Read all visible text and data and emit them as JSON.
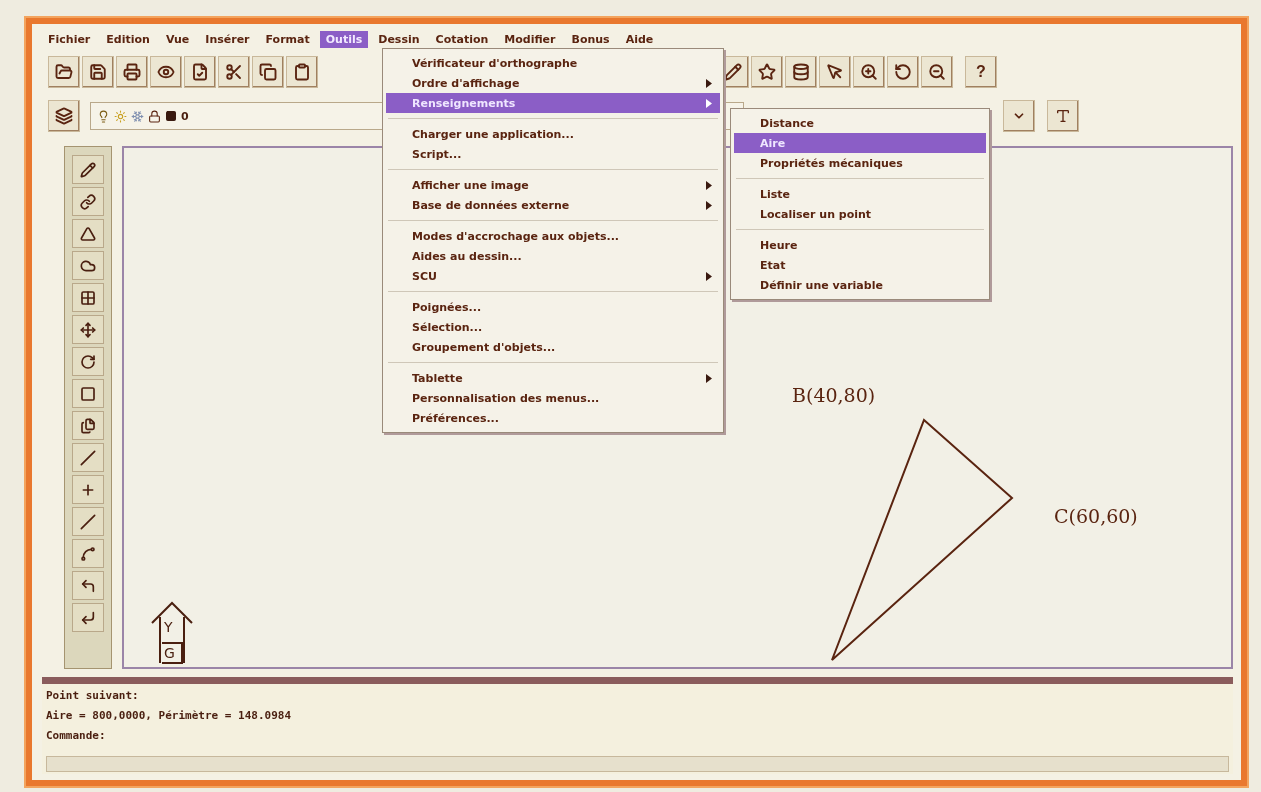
{
  "menu_bar": [
    {
      "label": "Fichier",
      "selected": false
    },
    {
      "label": "Edition",
      "selected": false
    },
    {
      "label": "Vue",
      "selected": false
    },
    {
      "label": "Insérer",
      "selected": false
    },
    {
      "label": "Format",
      "selected": false
    },
    {
      "label": "Outils",
      "selected": true
    },
    {
      "label": "Dessin",
      "selected": false
    },
    {
      "label": "Cotation",
      "selected": false
    },
    {
      "label": "Modifier",
      "selected": false
    },
    {
      "label": "Bonus",
      "selected": false
    },
    {
      "label": "Aide",
      "selected": false
    }
  ],
  "help_button": "?",
  "layer": {
    "name": "0"
  },
  "tools_menu": {
    "sections": [
      {
        "items": [
          {
            "label": "Vérificateur d'orthographe",
            "has_submenu": false,
            "selected": false
          },
          {
            "label": "Ordre d'affichage",
            "has_submenu": true,
            "selected": false
          },
          {
            "label": "Renseignements",
            "has_submenu": true,
            "selected": true
          }
        ]
      },
      {
        "items": [
          {
            "label": "Charger une application...",
            "has_submenu": false,
            "selected": false
          },
          {
            "label": "Script...",
            "has_submenu": false,
            "selected": false
          }
        ]
      },
      {
        "items": [
          {
            "label": "Afficher une image",
            "has_submenu": true,
            "selected": false
          },
          {
            "label": "Base de données externe",
            "has_submenu": true,
            "selected": false
          }
        ]
      },
      {
        "items": [
          {
            "label": "Modes d'accrochage aux objets...",
            "has_submenu": false,
            "selected": false
          },
          {
            "label": "Aides au dessin...",
            "has_submenu": false,
            "selected": false
          },
          {
            "label": "SCU",
            "has_submenu": true,
            "selected": false
          }
        ]
      },
      {
        "items": [
          {
            "label": "Poignées...",
            "has_submenu": false,
            "selected": false
          },
          {
            "label": "Sélection...",
            "has_submenu": false,
            "selected": false
          },
          {
            "label": "Groupement d'objets...",
            "has_submenu": false,
            "selected": false
          }
        ]
      },
      {
        "items": [
          {
            "label": "Tablette",
            "has_submenu": true,
            "selected": false
          },
          {
            "label": "Personnalisation des menus...",
            "has_submenu": false,
            "selected": false
          },
          {
            "label": "Préférences...",
            "has_submenu": false,
            "selected": false
          }
        ]
      }
    ]
  },
  "info_submenu": {
    "sections": [
      {
        "items": [
          {
            "label": "Distance",
            "selected": false
          },
          {
            "label": "Aire",
            "selected": true
          },
          {
            "label": "Propriétés mécaniques",
            "selected": false
          }
        ]
      },
      {
        "items": [
          {
            "label": "Liste",
            "selected": false
          },
          {
            "label": "Localiser un point",
            "selected": false
          }
        ]
      },
      {
        "items": [
          {
            "label": "Heure",
            "selected": false
          },
          {
            "label": "Etat",
            "selected": false
          },
          {
            "label": "Définir une variable",
            "selected": false
          }
        ]
      }
    ]
  },
  "canvas": {
    "point_labels": [
      "B(40,80)",
      "C(60,60)"
    ],
    "ucs_icon": {
      "y_label": "Y",
      "origin_label": "G"
    }
  },
  "command_lines": [
    "Point suivant:",
    "Aire = 800,0000, Périmètre = 148.0984",
    "Commande:"
  ]
}
